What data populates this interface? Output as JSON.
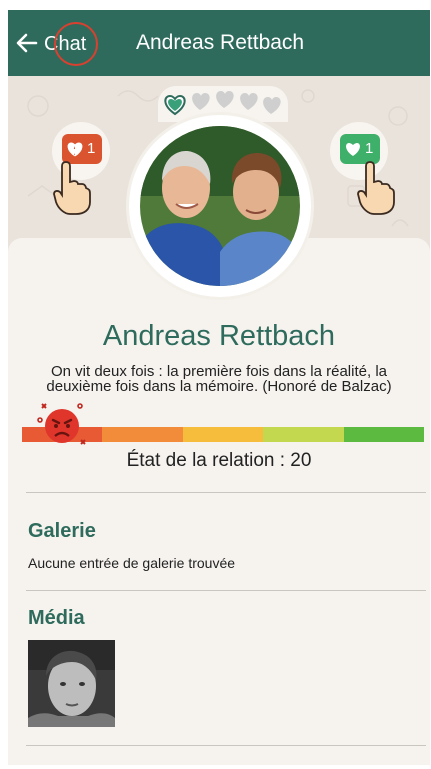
{
  "topbar": {
    "back_label": "Chat",
    "title": "Andreas Rettbach"
  },
  "icons": {
    "back": "arrow-left-icon",
    "dislike": "broken-heart-icon",
    "like": "heart-icon",
    "hand": "pointing-hand-icon",
    "angry": "angry-face-icon"
  },
  "dislike_count": "1",
  "like_count": "1",
  "profile": {
    "name": "Andreas Rettbach",
    "quote": "On vit deux fois : la première fois dans la réalité, la deuxième fois dans la mémoire. (Honoré de Balzac)"
  },
  "relationship": {
    "label": "État de la relation : 20",
    "value": 20,
    "colors": [
      "#e85a34",
      "#f28c3b",
      "#f6bd3c",
      "#c3d84e",
      "#5cba40"
    ]
  },
  "gallery": {
    "title": "Galerie",
    "empty_text": "Aucune entrée de galerie trouvée"
  },
  "media": {
    "title": "Média"
  },
  "colors": {
    "brand": "#2e6b5c",
    "accent_red": "#d9402f"
  }
}
